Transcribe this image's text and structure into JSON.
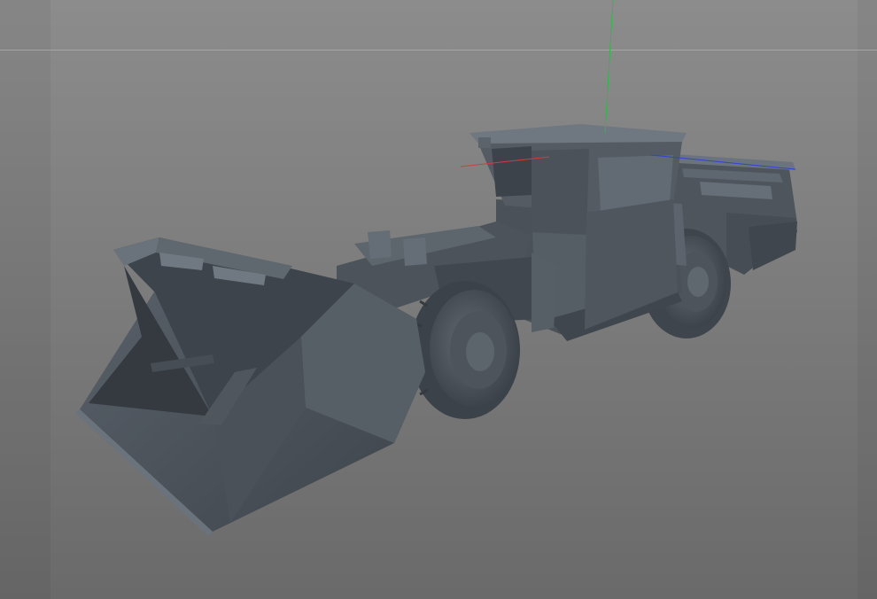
{
  "viewport": {
    "background_top": "#8c8c8c",
    "background_bottom": "#6a6a6a",
    "model_color": "#5a626b"
  },
  "axes": {
    "x_axis_color": "#d23c3c",
    "y_axis_color": "#2fb84a",
    "z_axis_color": "#2f43d8"
  }
}
